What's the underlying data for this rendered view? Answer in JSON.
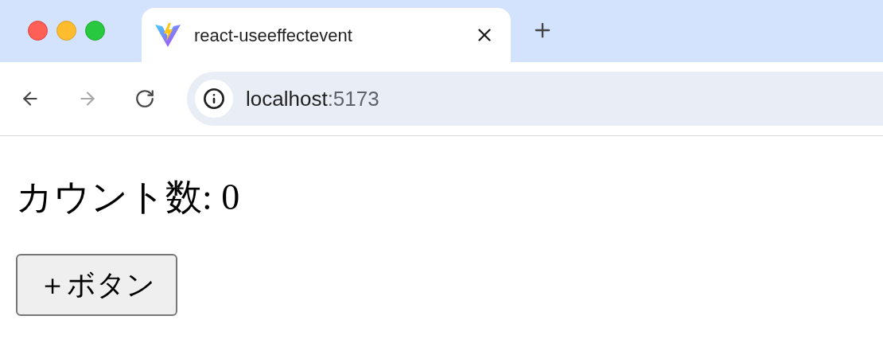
{
  "tab": {
    "title": "react-useeffectevent",
    "selected": true
  },
  "nav": [
    {
      "kind": "back",
      "disabled": false
    },
    {
      "kind": "forward",
      "disabled": true
    },
    {
      "kind": "reload",
      "disabled": false
    }
  ],
  "address": {
    "host": "localhost",
    "port": ":5173"
  },
  "page": {
    "heading": "カウント数: 0",
    "button": "＋ボタン"
  }
}
